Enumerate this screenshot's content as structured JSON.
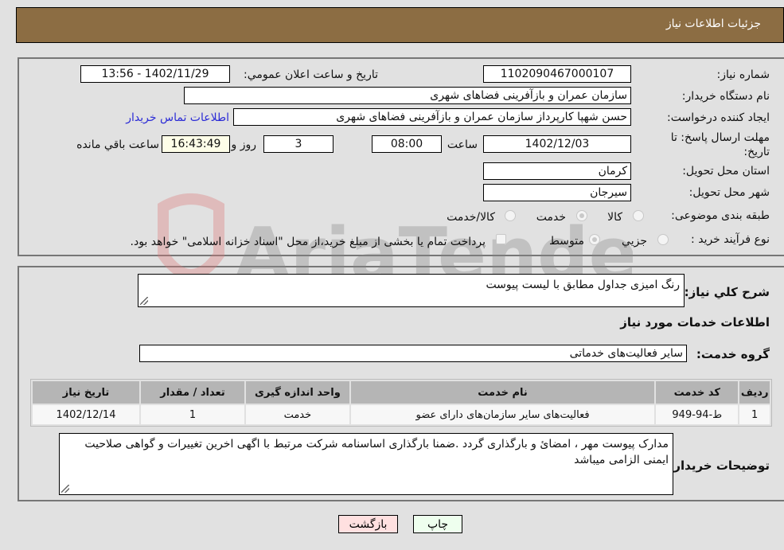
{
  "header": {
    "title": "جزئیات اطلاعات نیاز"
  },
  "details": {
    "need_number_label": "شماره نیاز:",
    "need_number": "1102090467000107",
    "announce_label": "تاریخ و ساعت اعلان عمومي:",
    "announce_value": "1402/11/29 - 13:56",
    "buyer_org_label": "نام دستگاه خریدار:",
    "buyer_org": "سازمان عمران و بازآفرینی فضاهای شهری",
    "creator_label": "ایجاد کننده درخواست:",
    "creator": "حسن شهپا کارپرداز سازمان عمران و بازآفرینی فضاهای شهری",
    "contact_link": "اطلاعات تماس خریدار",
    "deadline_label": "مهلت ارسال پاسخ: تا تاریخ:",
    "deadline_date": "1402/12/03",
    "time_label": "ساعت",
    "deadline_time": "08:00",
    "days_value": "3",
    "days_label": "روز و",
    "remaining_time": "16:43:49",
    "remaining_label": "ساعت باقي مانده",
    "province_label": "استان محل تحویل:",
    "province": "کرمان",
    "city_label": "شهر محل تحویل:",
    "city": "سیرجان",
    "category_label": "طبقه بندی موضوعی:",
    "category_options": [
      "کالا",
      "خدمت",
      "کالا/خدمت"
    ],
    "category_selected": "خدمت",
    "process_label": "نوع فرآیند خرید :",
    "process_options": [
      "جزيي",
      "متوسط"
    ],
    "process_selected": "متوسط",
    "treasury_note": "پرداخت تمام یا بخشی از مبلغ خرید،از محل \"اسناد خزانه اسلامی\" خواهد بود."
  },
  "description": {
    "label": "شرح کلي نیاز:",
    "value": "رنگ امیزی جداول مطابق با لیست پیوست"
  },
  "services": {
    "section_title": "اطلاعات خدمات مورد نیاز",
    "group_label": "گروه خدمت:",
    "group_value": "سایر فعالیت‌های خدماتی",
    "columns": [
      "ردیف",
      "کد خدمت",
      "نام خدمت",
      "واحد اندازه گیری",
      "تعداد / مقدار",
      "تاریخ نیاز"
    ],
    "rows": [
      [
        "1",
        "ط-94-949",
        "فعالیت‌های سایر سازمان‌های دارای عضو",
        "خدمت",
        "1",
        "1402/12/14"
      ]
    ]
  },
  "buyer_notes": {
    "label": "توضیحات خریدار:",
    "value": "مدارک پیوست مهر ، امضائ  و بارگذاری گردد  .ضمنا بارگذاری اساسنامه شرکت مرتبط با اگهی اخرین تغییرات و گواهی صلاحیت ایمنی الزامی میباشد"
  },
  "buttons": {
    "print": "چاپ",
    "back": "بازگشت"
  },
  "watermark": {
    "text": "AriaTender.neT"
  }
}
